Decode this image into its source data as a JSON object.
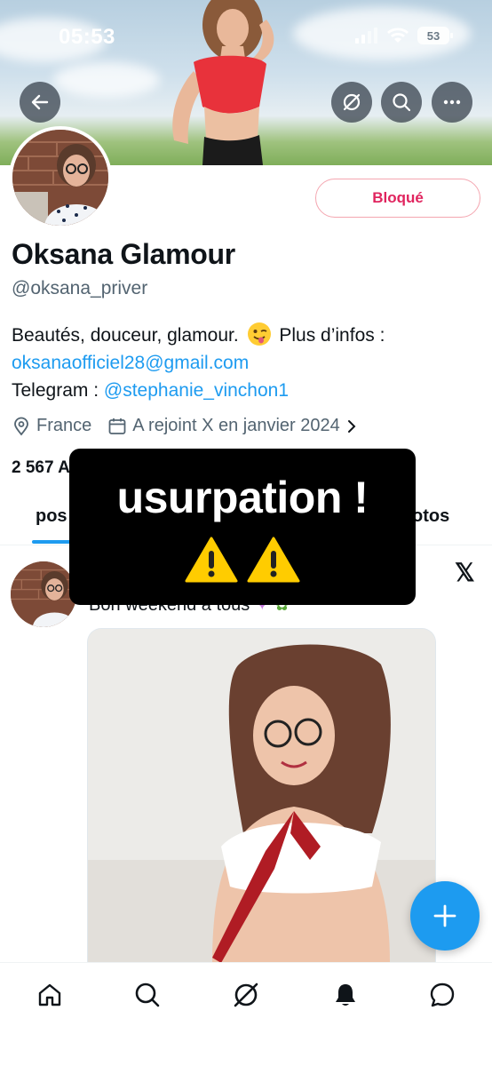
{
  "status_bar": {
    "time": "05:53",
    "battery": "53"
  },
  "header": {
    "back_icon": "arrow-left-icon",
    "actions": [
      "mute-icon",
      "search-icon",
      "more-icon"
    ]
  },
  "profile": {
    "blocked_label": "Bloqué",
    "name": "Oksana Glamour",
    "handle": "@oksana_priver",
    "bio_line1": "Beautés, douceur, glamour.",
    "bio_line1_after": "Plus d’infos :",
    "bio_email": "oksanaofficiel28@gmail.com",
    "bio_telegram_label": "Telegram :",
    "bio_telegram_handle": "@stephanie_vinchon1",
    "location": "France",
    "joined": "A rejoint X en janvier 2024",
    "following_count": "2 567 A"
  },
  "tabs": [
    {
      "label": "pos",
      "active": true
    },
    {
      "label": "otos",
      "active": false
    }
  ],
  "overlay": {
    "text": "usurpation !",
    "warning_icons": [
      "warning-icon",
      "warning-icon"
    ]
  },
  "post": {
    "text": "Bon weekend à tous",
    "source_icon": "x-logo-icon"
  },
  "fab": {
    "icon": "plus-icon"
  },
  "bottom_nav": [
    "home-icon",
    "search-icon",
    "grok-icon",
    "notifications-icon",
    "messages-icon"
  ],
  "colors": {
    "accent": "#1d9bf0",
    "blocked": "#e0245e",
    "text": "#0f1419",
    "secondary": "#536471"
  }
}
